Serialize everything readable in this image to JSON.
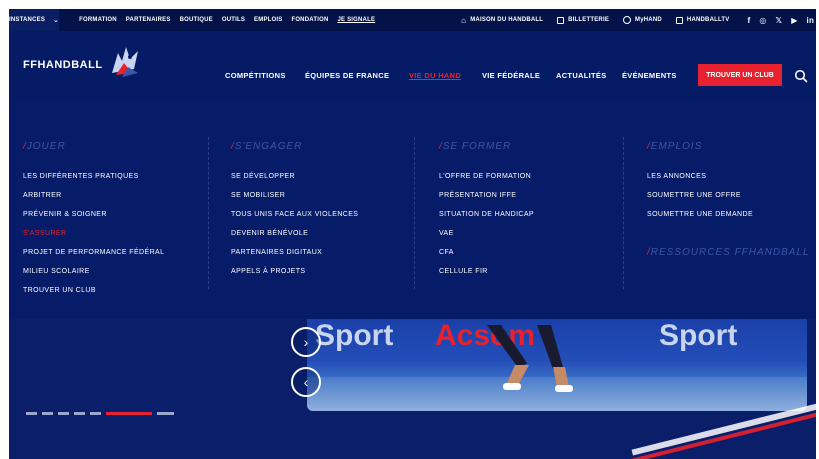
{
  "topbar": {
    "instances_label": "INSTANCES",
    "links": [
      "FORMATION",
      "PARTENAIRES",
      "BOUTIQUE",
      "OUTILS",
      "EMPLOIS",
      "FONDATION",
      "JE SIGNALE"
    ],
    "right_links": {
      "maison": "MAISON DU HANDBALL",
      "billetterie": "BILLETTERIE",
      "myhand": "MyHAND",
      "handballtv": "HANDBALLTV"
    },
    "social": [
      "f",
      "◎",
      "𝕏",
      "▶",
      "in",
      "♪"
    ]
  },
  "header": {
    "logo_text": "FFHANDBALL",
    "nav": {
      "competitions": "COMPÉTITIONS",
      "equipes": "ÉQUIPES DE FRANCE",
      "vie_du_hand": "VIE DU HAND",
      "vie_federale": "VIE FÉDÉRALE",
      "actualites": "ACTUALITÉS",
      "evenements": "ÉVÉNEMENTS"
    },
    "cta_label": "TROUVER UN CLUB"
  },
  "mega_menu": {
    "jouer": {
      "title": "JOUER",
      "items": [
        "LES DIFFÉRENTES PRATIQUES",
        "ARBITRER",
        "PRÉVENIR & SOIGNER",
        "S'ASSURER",
        "PROJET DE PERFORMANCE FÉDÉRAL",
        "MILIEU SCOLAIRE",
        "TROUVER UN CLUB"
      ]
    },
    "engager": {
      "title": "S'ENGAGER",
      "items": [
        "SE DÉVELOPPER",
        "SE MOBILISER",
        "TOUS UNIS FACE AUX VIOLENCES",
        "DEVENIR BÉNÉVOLE",
        "PARTENAIRES DIGITAUX",
        "APPELS À PROJETS"
      ]
    },
    "former": {
      "title": "SE FORMER",
      "items": [
        "L'OFFRE DE FORMATION",
        "PRÉSENTATION IFFE",
        "SITUATION DE HANDICAP",
        "VAE",
        "CFA",
        "CELLULE FIR"
      ]
    },
    "emplois": {
      "title": "EMPLOIS",
      "items": [
        "LES ANNONCES",
        "SOUMETTRE UNE OFFRE",
        "SOUMETTRE UNE DEMANDE"
      ],
      "ressources_title": "RESSOURCES FFHANDBALL"
    }
  },
  "hero": {
    "banner_texts": [
      "Sport",
      "Acsom",
      "Sport"
    ],
    "slides_total": 7,
    "active_slide": 6
  },
  "colors": {
    "navy": "#061b66",
    "accent_red": "#e8212e",
    "column_title": "#3c56a8"
  }
}
